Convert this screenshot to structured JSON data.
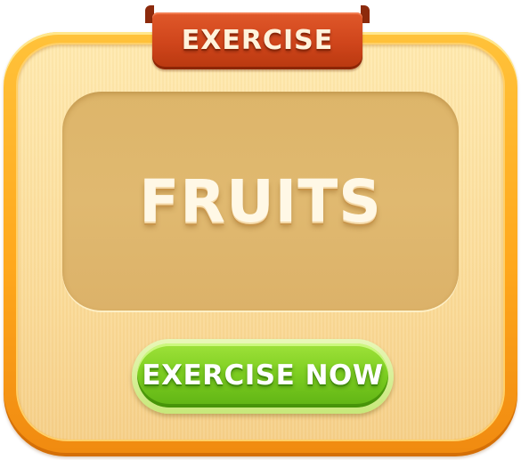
{
  "card": {
    "ribbon_label": "EXERCISE",
    "word": "FRUITS",
    "action_label": "EXERCISE NOW"
  },
  "colors": {
    "frame": "#ffa81c",
    "panel": "#fbdc9a",
    "word_box": "#ddb56a",
    "ribbon": "#cf451b",
    "button": "#7fcf22"
  }
}
